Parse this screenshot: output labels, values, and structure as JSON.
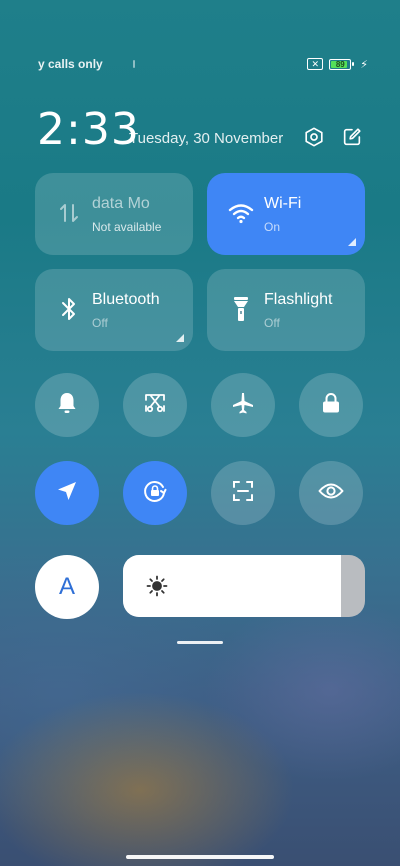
{
  "status_bar": {
    "carrier_text": "y calls only",
    "sim_badge": "✕",
    "battery_level": "89",
    "battery_fraction": 0.89,
    "charging_icon": "bolt-icon"
  },
  "header": {
    "time": "2:33",
    "date": "Tuesday, 30 November",
    "settings_icon": "settings-icon",
    "edit_icon": "edit-icon"
  },
  "tiles": {
    "mobile_data": {
      "title": "data      Mo",
      "subtitle": "Not available",
      "icon": "mobile-data-icon"
    },
    "wifi": {
      "title": "Wi-Fi",
      "subtitle": "On",
      "icon": "wifi-icon",
      "active": true
    },
    "bluetooth": {
      "title": "Bluetooth",
      "subtitle": "Off",
      "icon": "bluetooth-icon"
    },
    "flashlight": {
      "title": "Flashlight",
      "subtitle": "Off",
      "icon": "flashlight-icon"
    }
  },
  "toggles": [
    {
      "name": "silent",
      "icon": "bell-icon",
      "active": false
    },
    {
      "name": "screenshot",
      "icon": "screenshot-scissors-icon",
      "active": false
    },
    {
      "name": "airplane-mode",
      "icon": "airplane-icon",
      "active": false
    },
    {
      "name": "lock-screen",
      "icon": "lock-icon",
      "active": false
    },
    {
      "name": "location",
      "icon": "location-arrow-icon",
      "active": true
    },
    {
      "name": "rotation-lock",
      "icon": "rotation-lock-icon",
      "active": true
    },
    {
      "name": "scanner",
      "icon": "scan-icon",
      "active": false
    },
    {
      "name": "reading-mode",
      "icon": "eye-icon",
      "active": false
    }
  ],
  "auto_brightness": {
    "label": "A"
  },
  "brightness": {
    "level": 0.9,
    "icon": "sun-icon"
  },
  "colors": {
    "accent": "#3f86f5",
    "tile_bg": "rgba(255,255,255,0.16)",
    "battery_green": "#55e05a"
  }
}
